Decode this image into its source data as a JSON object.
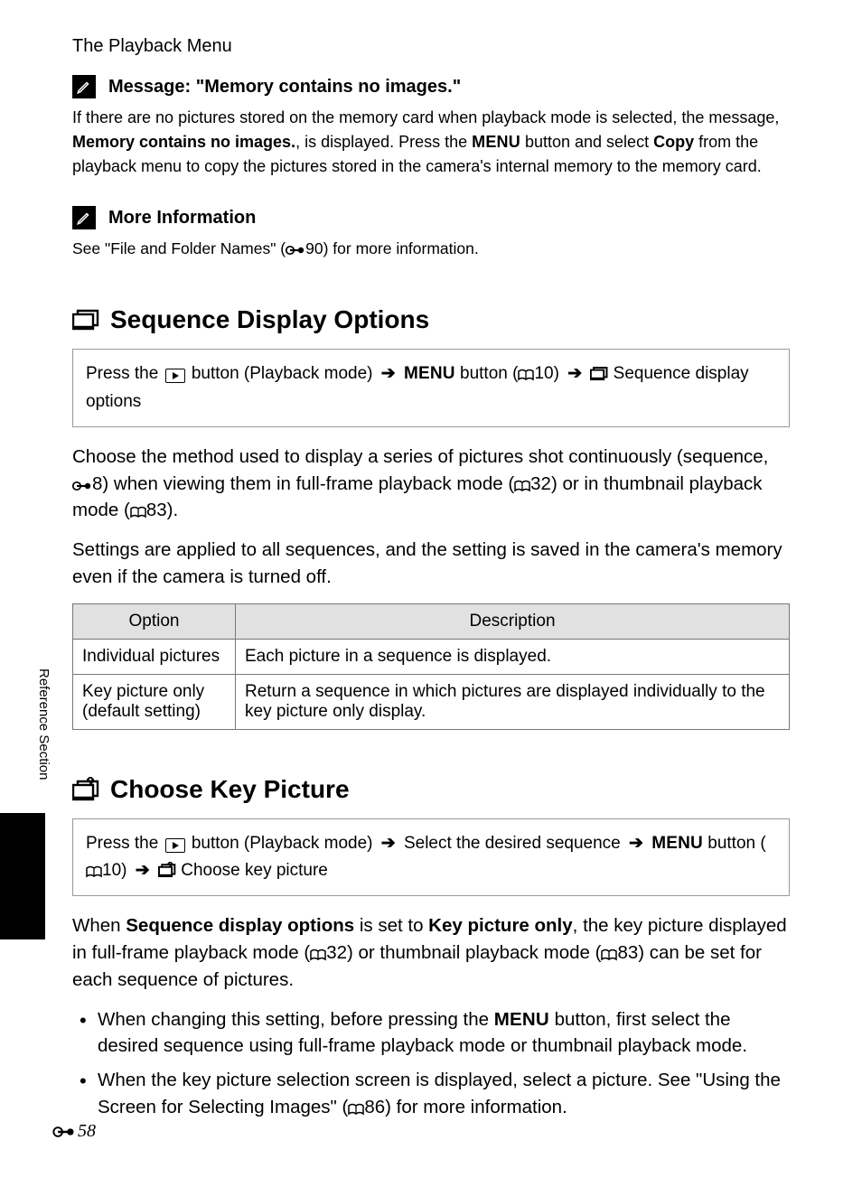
{
  "header": {
    "title": "The Playbook Menu",
    "title_actual": "The Playback Menu"
  },
  "note1": {
    "title": "Message: \"Memory contains no images.\"",
    "text_a": "If there are no pictures stored on the memory card when playback mode is selected, the message, ",
    "bold_a": "Memory contains no images.",
    "text_b": ", is displayed. Press the ",
    "menu": "MENU",
    "text_c": " button and select ",
    "bold_b": "Copy",
    "text_d": " from the playback menu to copy the pictures stored in the camera's internal memory to the memory card."
  },
  "note2": {
    "title": "More Information",
    "body": "See \"File and Folder Names\" (E90) for more information."
  },
  "sequence": {
    "heading": "Sequence Display Options",
    "nav_a": "Press the ",
    "nav_b": " button (Playback mode) ",
    "nav_menu": "MENU",
    "nav_c": " button (A10) ",
    "nav_d": " Sequence display options",
    "para1": "Choose the method used to display a series of pictures shot continuously (sequence, E8) when viewing them in full-frame playback mode (A32) or in thumbnail playback mode (A83).",
    "para2": "Settings are applied to all sequences, and the setting is saved in the camera's memory even if the camera is turned off.",
    "table": {
      "col1": "Option",
      "col2": "Description",
      "rows": [
        {
          "option": "Individual pictures",
          "desc": "Each picture in a sequence is displayed."
        },
        {
          "option": "Key picture only (default setting)",
          "desc": "Return a sequence in which pictures are displayed individually to the key picture only display."
        }
      ]
    }
  },
  "choosekey": {
    "heading": "Choose Key Picture",
    "nav_a": "Press the ",
    "nav_b": " button (Playback mode) ",
    "nav_c": " Select the desired sequence ",
    "nav_menu": "MENU",
    "nav_d": " button (A10) ",
    "nav_e": " Choose key picture",
    "para_a": "When ",
    "para_b1": "Sequence display options",
    "para_c": " is set to ",
    "para_b2": "Key picture only",
    "para_d": ", the key picture displayed in full-frame playback mode (A32) or thumbnail playback mode (A83) can be set for each sequence of pictures.",
    "bullets": [
      {
        "a": "When changing this setting, before pressing the ",
        "menu": "MENU",
        "b": " button, first select the desired sequence using full-frame playback mode or thumbnail playback mode."
      },
      {
        "a": "When the key picture selection screen is displayed, select a picture. See \"Using the Screen for Selecting Images\" (A86) for more information."
      }
    ]
  },
  "sidebar": {
    "label": "Reference Section"
  },
  "page_number": "58"
}
